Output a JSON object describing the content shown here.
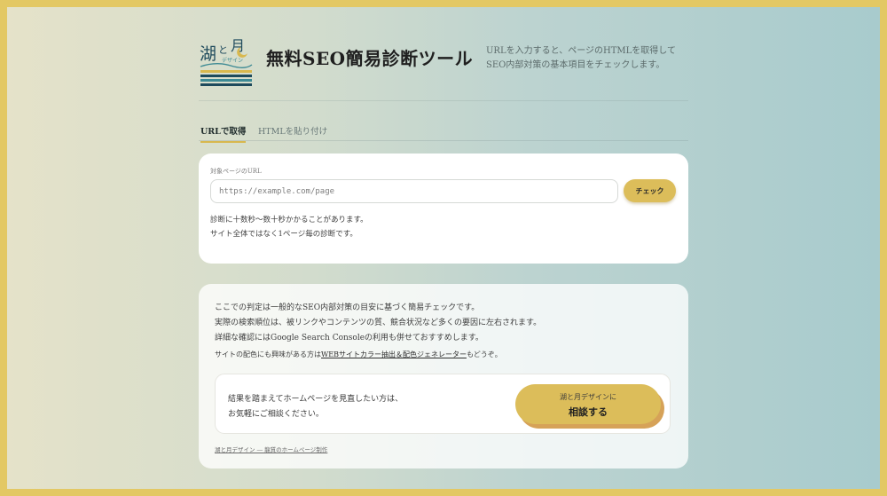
{
  "header": {
    "logo_text_1": "湖",
    "logo_text_2": "と",
    "logo_text_3": "月",
    "logo_text_4": "デザイン",
    "title": "無料SEO簡易診断ツール",
    "description_line1": "URLを入力すると、ページのHTMLを取得して",
    "description_line2": "SEO内部対策の基本項目をチェックします。"
  },
  "tabs": [
    {
      "label": "URLで取得",
      "active": true
    },
    {
      "label": "HTMLを貼り付け",
      "active": false
    }
  ],
  "url_form": {
    "label": "対象ページのURL",
    "placeholder": "https://example.com/page",
    "value": "",
    "button_label": "チェック",
    "note_line1": "診断に十数秒～数十秒かかることがあります。",
    "note_line2": "サイト全体ではなく1ページ毎の診断です。"
  },
  "info": {
    "line1": "ここでの判定は一般的なSEO内部対策の目安に基づく簡易チェックです。",
    "line2": "実際の検索順位は、被リンクやコンテンツの質、競合状況など多くの要因に左右されます。",
    "line3": "詳細な確認にはGoogle Search Consoleの利用も併せておすすめします。",
    "line4_prefix": "サイトの配色にも興味がある方は",
    "line4_link": "WEBサイトカラー抽出＆配色ジェネレーター",
    "line4_suffix": "もどうぞ。"
  },
  "consult": {
    "text_line1": "結果を踏まえてホームページを見直したい方は、",
    "text_line2": "お気軽にご相談ください。",
    "button_sub": "湖と月デザインに",
    "button_main": "相談する"
  },
  "footer": {
    "link": "湖と月デザイン ― 龍質のホームページ制作"
  },
  "colors": {
    "accent": "#dcbd5a",
    "frame": "#e3c864",
    "logo_navy": "#1e4a5c",
    "logo_teal": "#3d8a94",
    "logo_gold": "#d8b84e"
  }
}
